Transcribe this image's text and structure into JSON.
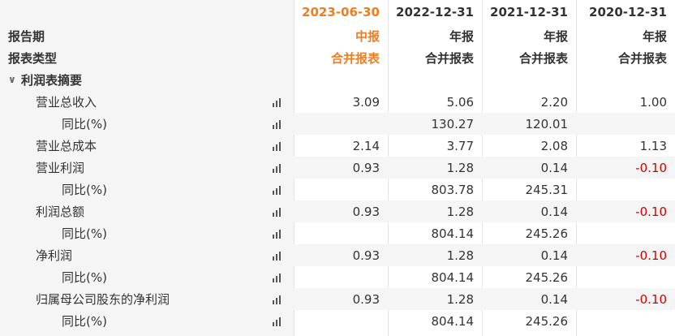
{
  "header": {
    "row1": [
      "",
      "2023-06-30",
      "2022-12-31",
      "2021-12-31",
      "2020-12-31"
    ],
    "row2": [
      "报告期",
      "中报",
      "年报",
      "年报",
      "年报"
    ],
    "row3": [
      "报表类型",
      "合并报表",
      "合并报表",
      "合并报表",
      "合并报表"
    ]
  },
  "section": {
    "label": "利润表摘要",
    "chevron": "chevron-down-icon"
  },
  "rows": [
    {
      "label": "营业总收入",
      "values": [
        "3.09",
        "5.06",
        "2.20",
        "1.00"
      ]
    },
    {
      "label": "同比(%)",
      "values": [
        "",
        "130.27",
        "120.01",
        ""
      ]
    },
    {
      "label": "营业总成本",
      "values": [
        "2.14",
        "3.77",
        "2.08",
        "1.13"
      ]
    },
    {
      "label": "营业利润",
      "values": [
        "0.93",
        "1.28",
        "0.14",
        "-0.10"
      ]
    },
    {
      "label": "同比(%)",
      "values": [
        "",
        "803.78",
        "245.31",
        ""
      ]
    },
    {
      "label": "利润总额",
      "values": [
        "0.93",
        "1.28",
        "0.14",
        "-0.10"
      ]
    },
    {
      "label": "同比(%)",
      "values": [
        "",
        "804.14",
        "245.26",
        ""
      ]
    },
    {
      "label": "净利润",
      "values": [
        "0.93",
        "1.28",
        "0.14",
        "-0.10"
      ]
    },
    {
      "label": "同比(%)",
      "values": [
        "",
        "804.14",
        "245.26",
        ""
      ]
    },
    {
      "label": "归属母公司股东的净利润",
      "values": [
        "0.93",
        "1.28",
        "0.14",
        "-0.10"
      ]
    },
    {
      "label": "同比(%)",
      "values": [
        "",
        "804.14",
        "245.26",
        ""
      ]
    }
  ],
  "colors": {
    "highlight": "#f27d21",
    "negative": "#d40000",
    "label_bg": "#f5f5f5"
  },
  "icons": {
    "row_action": "bar-chart-icon"
  }
}
